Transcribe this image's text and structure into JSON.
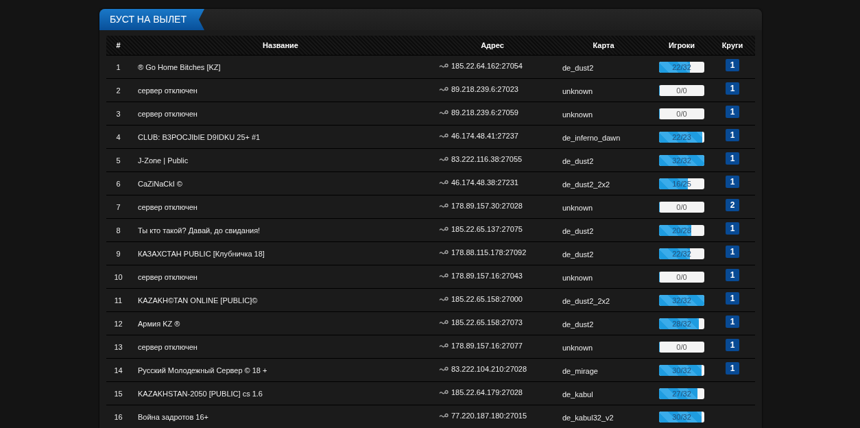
{
  "panel": {
    "title": "БУСТ НА ВЫЛЕТ"
  },
  "table": {
    "columns": [
      "#",
      "Название",
      "Адрес",
      "Карта",
      "Игроки",
      "Круги"
    ],
    "rows": [
      {
        "num": "1",
        "name": "® Go Home Bitches [KZ]",
        "address": "185.22.64.162:27054",
        "map": "de_dust2",
        "players": "22/32",
        "level": 0.6875,
        "laps": "1"
      },
      {
        "num": "2",
        "name": "сервер отключен",
        "address": "89.218.239.6:27023",
        "map": "unknown",
        "players": "0/0",
        "level": 0,
        "laps": "1"
      },
      {
        "num": "3",
        "name": "сервер отключен",
        "address": "89.218.239.6:27059",
        "map": "unknown",
        "players": "0/0",
        "level": 0,
        "laps": "1"
      },
      {
        "num": "4",
        "name": "CLUB: B3POCJIbIE D9IDKU 25+ #1",
        "address": "46.174.48.41:27237",
        "map": "de_inferno_dawn",
        "players": "22/23",
        "level": 0.957,
        "laps": "1"
      },
      {
        "num": "5",
        "name": "J-Zone | Public",
        "address": "83.222.116.38:27055",
        "map": "de_dust2",
        "players": "32/32",
        "level": 1,
        "laps": "1"
      },
      {
        "num": "6",
        "name": "CaZiNaCkI ©",
        "address": "46.174.48.38:27231",
        "map": "de_dust2_2x2",
        "players": "16/25",
        "level": 0.64,
        "laps": "1"
      },
      {
        "num": "7",
        "name": "сервер отключен",
        "address": "178.89.157.30:27028",
        "map": "unknown",
        "players": "0/0",
        "level": 0,
        "laps": "2"
      },
      {
        "num": "8",
        "name": "Ты кто такой? Давай, до свидания!",
        "address": "185.22.65.137:27075",
        "map": "de_dust2",
        "players": "20/28",
        "level": 0.714,
        "laps": "1"
      },
      {
        "num": "9",
        "name": "КАЗАХСТАН PUBLIC [Клубничка 18]",
        "address": "178.88.115.178:27092",
        "map": "de_dust2",
        "players": "22/32",
        "level": 0.6875,
        "laps": "1"
      },
      {
        "num": "10",
        "name": "сервер отключен",
        "address": "178.89.157.16:27043",
        "map": "unknown",
        "players": "0/0",
        "level": 0,
        "laps": "1"
      },
      {
        "num": "11",
        "name": "KAZAKH©TAN ONLINE [PUBLIC]©",
        "address": "185.22.65.158:27000",
        "map": "de_dust2_2x2",
        "players": "32/32",
        "level": 1,
        "laps": "1"
      },
      {
        "num": "12",
        "name": "Армия KZ ®",
        "address": "185.22.65.158:27073",
        "map": "de_dust2",
        "players": "28/32",
        "level": 0.875,
        "laps": "1"
      },
      {
        "num": "13",
        "name": "сервер отключен",
        "address": "178.89.157.16:27077",
        "map": "unknown",
        "players": "0/0",
        "level": 0,
        "laps": "1"
      },
      {
        "num": "14",
        "name": "Русский Молодежный Сервер © 18 +",
        "address": "83.222.104.210:27028",
        "map": "de_mirage",
        "players": "30/32",
        "level": 0.9375,
        "laps": "1"
      },
      {
        "num": "15",
        "name": "KAZAKHSTAN-2050 [PUBLIC] cs 1.6",
        "address": "185.22.64.179:27028",
        "map": "de_kabul",
        "players": "27/32",
        "level": 0.84375
      },
      {
        "num": "16",
        "name": "Война задротов 16+",
        "address": "77.220.187.180:27015",
        "map": "de_kabul32_v2",
        "players": "30/32",
        "level": 0.9375
      }
    ]
  }
}
